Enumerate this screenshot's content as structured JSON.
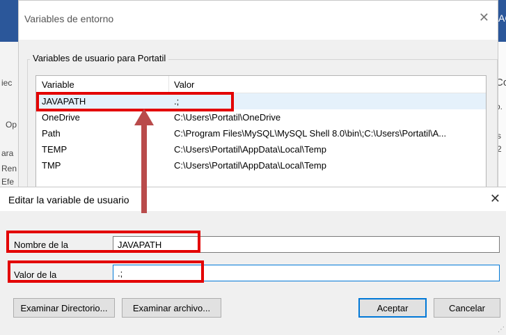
{
  "background": {
    "right_title_fragment": "AC",
    "left_fragments": [
      "iec",
      "Op",
      "ara",
      "Ren",
      "Efe"
    ],
    "right_fragments": [
      "Co",
      "o.",
      "s",
      "2"
    ]
  },
  "env_window": {
    "title": "Variables de entorno",
    "group_label": "Variables de usuario para Portatil",
    "columns": {
      "variable": "Variable",
      "value": "Valor"
    },
    "rows": [
      {
        "name": "JAVAPATH",
        "value": ".;"
      },
      {
        "name": "OneDrive",
        "value": "C:\\Users\\Portatil\\OneDrive"
      },
      {
        "name": "Path",
        "value": "C:\\Program Files\\MySQL\\MySQL Shell 8.0\\bin\\;C:\\Users\\Portatil\\A..."
      },
      {
        "name": "TEMP",
        "value": "C:\\Users\\Portatil\\AppData\\Local\\Temp"
      },
      {
        "name": "TMP",
        "value": "C:\\Users\\Portatil\\AppData\\Local\\Temp"
      }
    ]
  },
  "edit_dialog": {
    "title": "Editar la variable de usuario",
    "name_label": "Nombre de la",
    "name_value": "JAVAPATH",
    "value_label": "Valor de la",
    "value_value": ".;",
    "buttons": {
      "browse_dir": "Examinar Directorio...",
      "browse_file": "Examinar archivo...",
      "ok": "Aceptar",
      "cancel": "Cancelar"
    }
  },
  "icons": {
    "close": "✕"
  },
  "colors": {
    "annotation_red": "#e30000",
    "arrow": "#b94b4b",
    "accent": "#0078d7",
    "bg_app_blue": "#2b579a"
  }
}
